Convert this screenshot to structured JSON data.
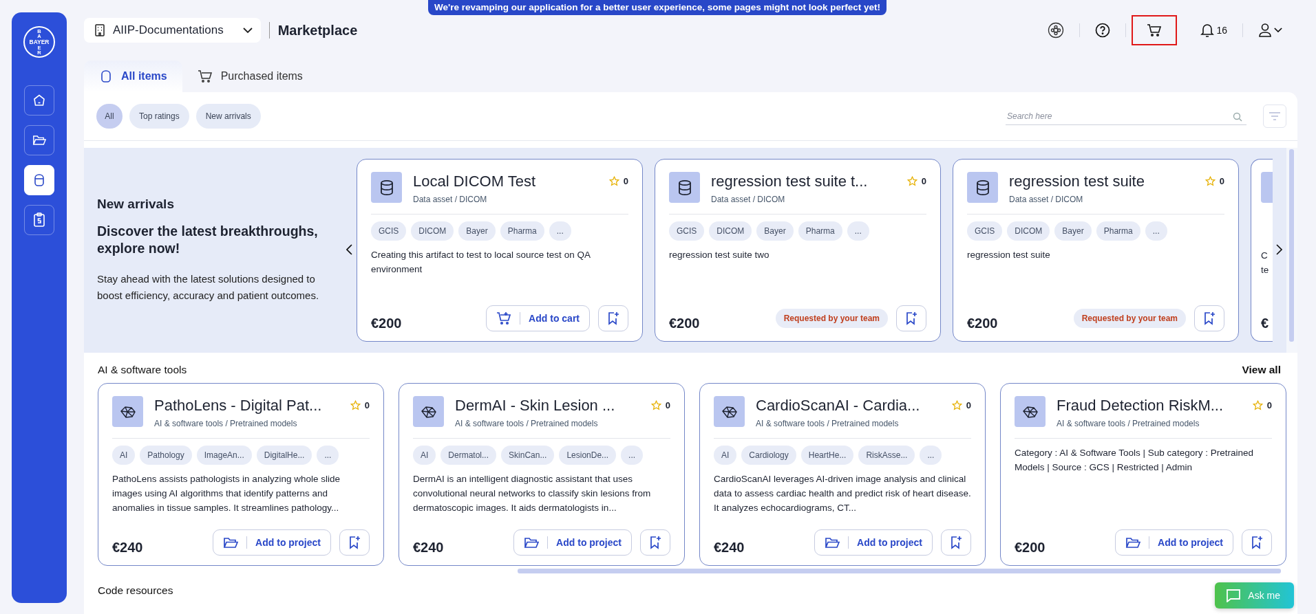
{
  "notice": "We're revamping our application for a better user experience, some pages might not look perfect yet!",
  "logo": {
    "top": "BA",
    "middle": "BAYER",
    "bottom": "ER"
  },
  "sidebar": {
    "items": [
      {
        "kind": "home",
        "selected": false
      },
      {
        "kind": "folder",
        "selected": false
      },
      {
        "kind": "bag",
        "selected": true
      },
      {
        "kind": "clipboard",
        "selected": false
      }
    ]
  },
  "header": {
    "workspace": "AIIP-Documentations",
    "title": "Marketplace",
    "notifications": "16",
    "cart_highlighted": true
  },
  "tabs": [
    {
      "label": "All items",
      "kind": "bag",
      "selected": true
    },
    {
      "label": "Purchased items",
      "kind": "cart",
      "selected": false
    }
  ],
  "filters": [
    {
      "label": "All",
      "selected": true
    },
    {
      "label": "Top ratings",
      "selected": false
    },
    {
      "label": "New arrivals",
      "selected": false
    }
  ],
  "search": {
    "placeholder": "Search here"
  },
  "new_arrivals": {
    "heading": "New arrivals",
    "subheading": "Discover the latest breakthroughs, explore now!",
    "text": "Stay ahead with the latest solutions designed to boost efficiency, accuracy and patient outcomes.",
    "cards": [
      {
        "kind": "dataset",
        "title": "Local DICOM Test",
        "rating": "0",
        "category": "Data asset / DICOM",
        "tags": [
          "GCIS",
          "DICOM",
          "Bayer",
          "Pharma",
          "..."
        ],
        "description": "Creating this artifact to test to local source test on QA environment",
        "price": "€200",
        "action": {
          "kind": "cart",
          "label": "Add to cart"
        }
      },
      {
        "kind": "dataset",
        "title": "regression test suite t...",
        "rating": "0",
        "category": "Data asset / DICOM",
        "tags": [
          "GCIS",
          "DICOM",
          "Bayer",
          "Pharma",
          "..."
        ],
        "description": "regression test suite two",
        "price": "€200",
        "status": "Requested by your team"
      },
      {
        "kind": "dataset",
        "title": "regression test suite",
        "rating": "0",
        "category": "Data asset / DICOM",
        "tags": [
          "GCIS",
          "DICOM",
          "Bayer",
          "Pharma",
          "..."
        ],
        "description": "regression test suite",
        "price": "€200",
        "status": "Requested by your team"
      }
    ],
    "peek_card": {
      "lines": [
        "C",
        "te"
      ],
      "price": "€"
    }
  },
  "sections": [
    {
      "heading": "AI & software tools",
      "view_all": "View all",
      "cards": [
        {
          "kind": "model",
          "title": "PathoLens - Digital Pat...",
          "rating": "0",
          "category": "AI & software tools / Pretrained models",
          "tags": [
            "AI",
            "Pathology",
            "ImageAn...",
            "DigitalHe...",
            "..."
          ],
          "description": "PathoLens assists pathologists in analyzing whole slide images using AI algorithms that identify patterns and anomalies in tissue samples. It streamlines pathology...",
          "price": "€240",
          "action": {
            "kind": "project",
            "label": "Add to project"
          }
        },
        {
          "kind": "model",
          "title": "DermAI - Skin Lesion ...",
          "rating": "0",
          "category": "AI & software tools / Pretrained models",
          "tags": [
            "AI",
            "Dermatol...",
            "SkinCan...",
            "LesionDe...",
            "..."
          ],
          "description": "DermAI is an intelligent diagnostic assistant that uses convolutional neural networks to classify skin lesions from dermatoscopic images. It aids dermatologists in...",
          "price": "€240",
          "action": {
            "kind": "project",
            "label": "Add to project"
          }
        },
        {
          "kind": "model",
          "title": "CardioScanAI - Cardia...",
          "rating": "0",
          "category": "AI & software tools / Pretrained models",
          "tags": [
            "AI",
            "Cardiology",
            "HeartHe...",
            "RiskAsse...",
            "..."
          ],
          "description": "CardioScanAI leverages AI-driven image analysis and clinical data to assess cardiac health and predict risk of heart disease. It analyzes echocardiograms, CT...",
          "price": "€240",
          "action": {
            "kind": "project",
            "label": "Add to project"
          }
        },
        {
          "kind": "model",
          "title": "Fraud Detection RiskM...",
          "rating": "0",
          "category": "AI & software tools / Pretrained models",
          "description": "Category : AI & Software Tools | Sub category : Pretrained Models | Source : GCS | Restricted | Admin",
          "price": "€200",
          "action": {
            "kind": "project",
            "label": "Add to project"
          }
        }
      ]
    },
    {
      "heading": "Code resources"
    }
  ],
  "ask_me": "Ask me"
}
